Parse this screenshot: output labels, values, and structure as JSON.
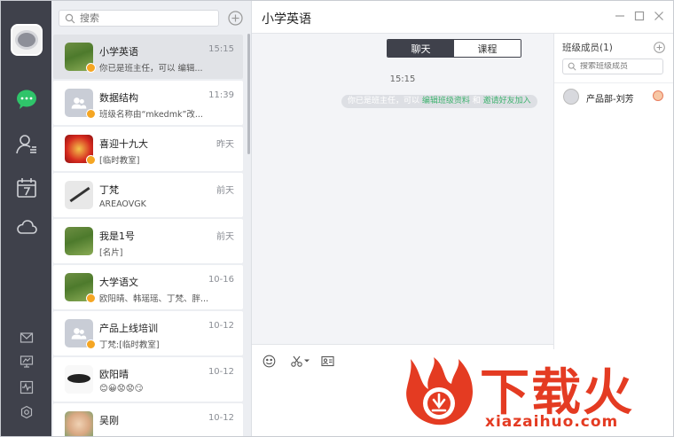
{
  "list": {
    "search_placeholder": "搜索",
    "items": [
      {
        "name": "小学英语",
        "time": "15:15",
        "preview": "你已是班主任，可以 编辑..."
      },
      {
        "name": "数据结构",
        "time": "11:39",
        "preview": "班级名称由“mkedmk”改..."
      },
      {
        "name": "喜迎十九大",
        "time": "昨天",
        "preview": "[临时教室]"
      },
      {
        "name": "丁梵",
        "time": "前天",
        "preview": "AREAOVGK"
      },
      {
        "name": "我是1号",
        "time": "前天",
        "preview": "[名片]"
      },
      {
        "name": "大学语文",
        "time": "10-16",
        "preview": "欧阳晴、韩瑶瑶、丁梵、胖..."
      },
      {
        "name": "产品上线培训",
        "time": "10-12",
        "preview": "丁梵:[临时教室]"
      },
      {
        "name": "欧阳晴",
        "time": "10-12",
        "preview": "😊😀😟😟😏"
      },
      {
        "name": "吴刚",
        "time": "10-12",
        "preview": ""
      }
    ]
  },
  "chat": {
    "title": "小学英语",
    "tabs": {
      "chat": "聊天",
      "course": "课程"
    },
    "time": "15:15",
    "system_message": {
      "part1": "你已是班主任，可以 ",
      "link1": "编辑班级资料",
      "part2": " 和 ",
      "link2": "邀请好友加入"
    }
  },
  "members": {
    "title": "班级成员(1)",
    "search_placeholder": "搜索班级成员",
    "list": [
      {
        "name": "产品部-刘芳"
      }
    ]
  },
  "watermark": {
    "text": "下载火",
    "url": "xiazaihuo.com"
  },
  "colors": {
    "nav_bg": "#3f414b",
    "accent_green": "#3fb36f",
    "watermark_red": "#e43b22"
  }
}
